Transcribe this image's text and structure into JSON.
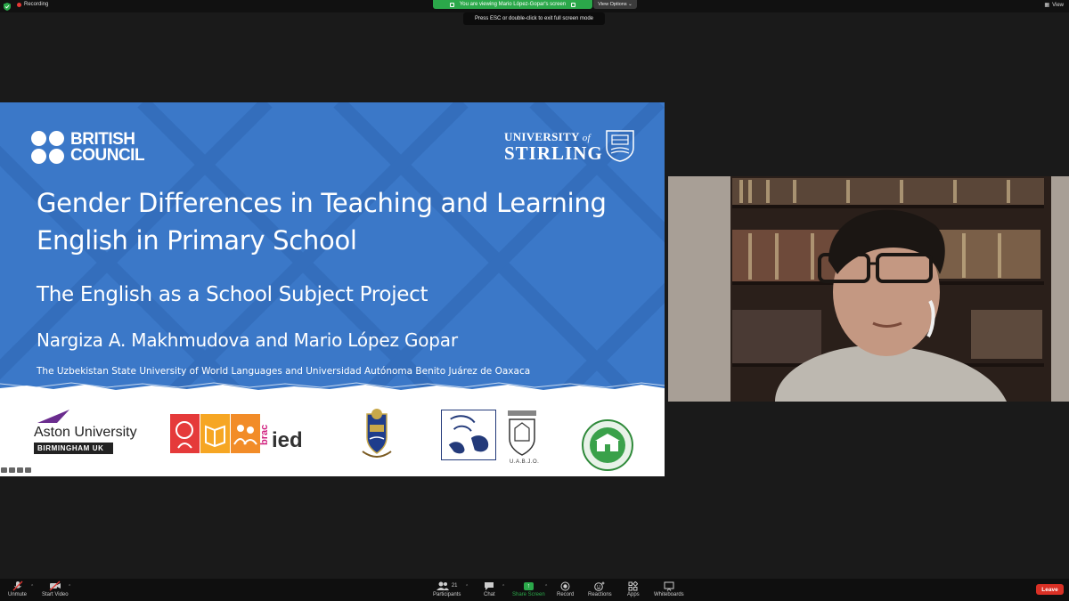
{
  "topbar": {
    "recording_label": "Recording",
    "viewing_label": "You are viewing Mario López-Gopar's screen",
    "view_options_label": "View Options",
    "esc_hint": "Press ESC or double-click to exit full screen mode",
    "view_label": "View",
    "colors": {
      "recording": "#e53935",
      "viewing_banner": "#2ba84a"
    }
  },
  "slide": {
    "brand_left": [
      "BRITISH",
      "COUNCIL"
    ],
    "brand_right_university": "UNIVERSITY",
    "brand_right_of": "of",
    "brand_right_name": "STIRLING",
    "title_line1": "Gender Differences in Teaching and Learning",
    "title_line2": "English in Primary School",
    "subtitle": "The English as a School Subject Project",
    "authors": "Nargiza A. Makhmudova and Mario López Gopar",
    "affiliation": "The Uzbekistan State University of World Languages and Universidad Autónoma Benito Juárez de Oaxaca",
    "background_color": "#3b78c8",
    "partner_logos": {
      "aston_name": "Aston University",
      "aston_sub": "BIRMINGHAM UK",
      "brac_word": "brac",
      "brac_ied": "ied",
      "uabjo": "U.A.B.J.O."
    }
  },
  "video": {
    "icons": [
      "person-video-feed"
    ]
  },
  "toolbar": {
    "unmute": "Unmute",
    "start_video": "Start Video",
    "participants": "Participants",
    "participants_count": "21",
    "chat": "Chat",
    "share_screen": "Share Screen",
    "record": "Record",
    "reactions": "Reactions",
    "apps": "Apps",
    "whiteboards": "Whiteboards",
    "leave": "Leave",
    "colors": {
      "share": "#2ba84a",
      "leave": "#d93025"
    }
  }
}
